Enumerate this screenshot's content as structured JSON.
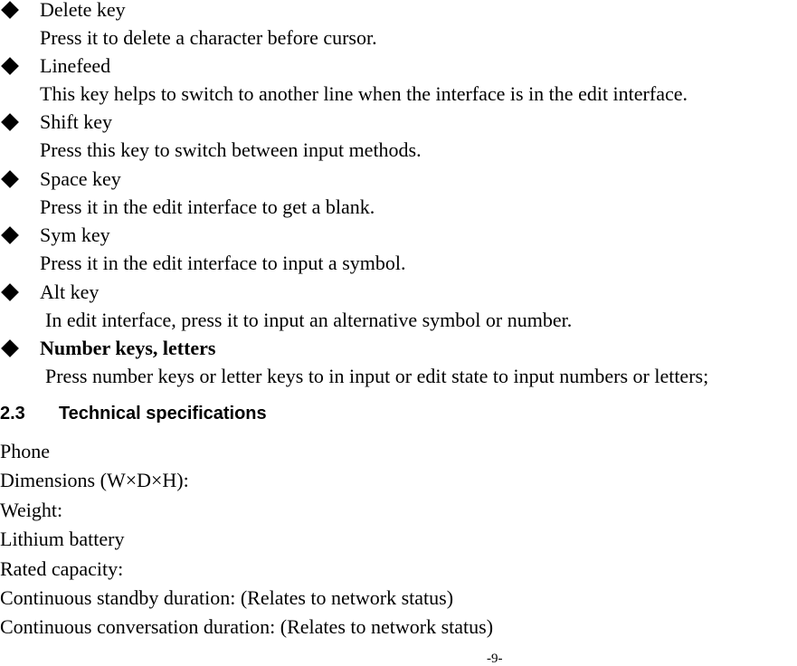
{
  "items": [
    {
      "title": "Delete key",
      "desc": "Press it to delete a character before cursor."
    },
    {
      "title": "Linefeed",
      "desc": "This key helps to switch to another line when the interface is in the edit interface."
    },
    {
      "title": "Shift key",
      "desc": "Press this key to switch between input methods."
    },
    {
      "title": "Space key",
      "desc": "Press it in the edit interface to get a blank."
    },
    {
      "title": "Sym key",
      "desc": "Press it in the edit interface to input a symbol."
    },
    {
      "title": "Alt key",
      "desc": "In edit interface, press it to input an alternative symbol or number."
    },
    {
      "title": "Number keys, letters",
      "desc": "Press number keys or letter keys to in input or edit state to input numbers or letters;"
    }
  ],
  "section": {
    "number": "2.3",
    "title": "Technical specifications"
  },
  "specs": [
    "Phone",
    "Dimensions (W×D×H):",
    "Weight:",
    "Lithium battery",
    "Rated capacity:",
    "Continuous standby duration: (Relates to network status)",
    "Continuous conversation duration: (Relates to network status)"
  ],
  "footer": {
    "page": "-9-"
  }
}
